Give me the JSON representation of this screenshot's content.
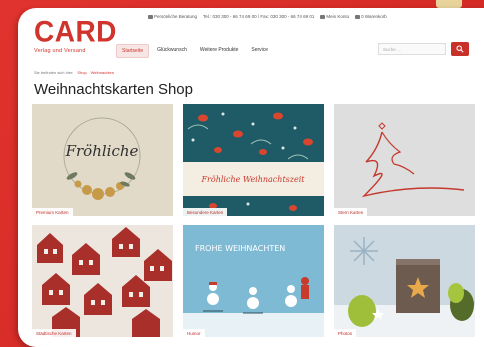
{
  "brand": {
    "logo": "CARD",
    "tagline": "Verlag und Versand"
  },
  "topbar": {
    "support": "Persönliche Beratung",
    "phone": "Tel.: 030 300 - 66 74 69 00 / Fax: 030 300 - 66 74 69 01",
    "account": "Mein Konto",
    "cart": "0 Warenkorb"
  },
  "nav": {
    "items": [
      {
        "label": "Startseite",
        "active": true
      },
      {
        "label": "Glückwunsch",
        "active": false
      },
      {
        "label": "Weitere Produkte",
        "active": false
      },
      {
        "label": "Service",
        "active": false
      }
    ]
  },
  "search": {
    "placeholder": "Suche ..."
  },
  "breadcrumb": {
    "home": "Sie befinden sich hier:",
    "level1": "Shop",
    "level2": "Weihnachten"
  },
  "page": {
    "title": "Weihnachtskarten Shop"
  },
  "tiles": [
    {
      "label": "Premium Karten",
      "art_text": "Fröhliche"
    },
    {
      "label": "Besondere Karten",
      "art_text": "Fröhliche Weihnachtszeit"
    },
    {
      "label": "Stern Karten"
    },
    {
      "label": "Städtische Karten"
    },
    {
      "label": "Humor",
      "art_text": "FROHE WEIHNACHTEN"
    },
    {
      "label": "Photos"
    }
  ]
}
